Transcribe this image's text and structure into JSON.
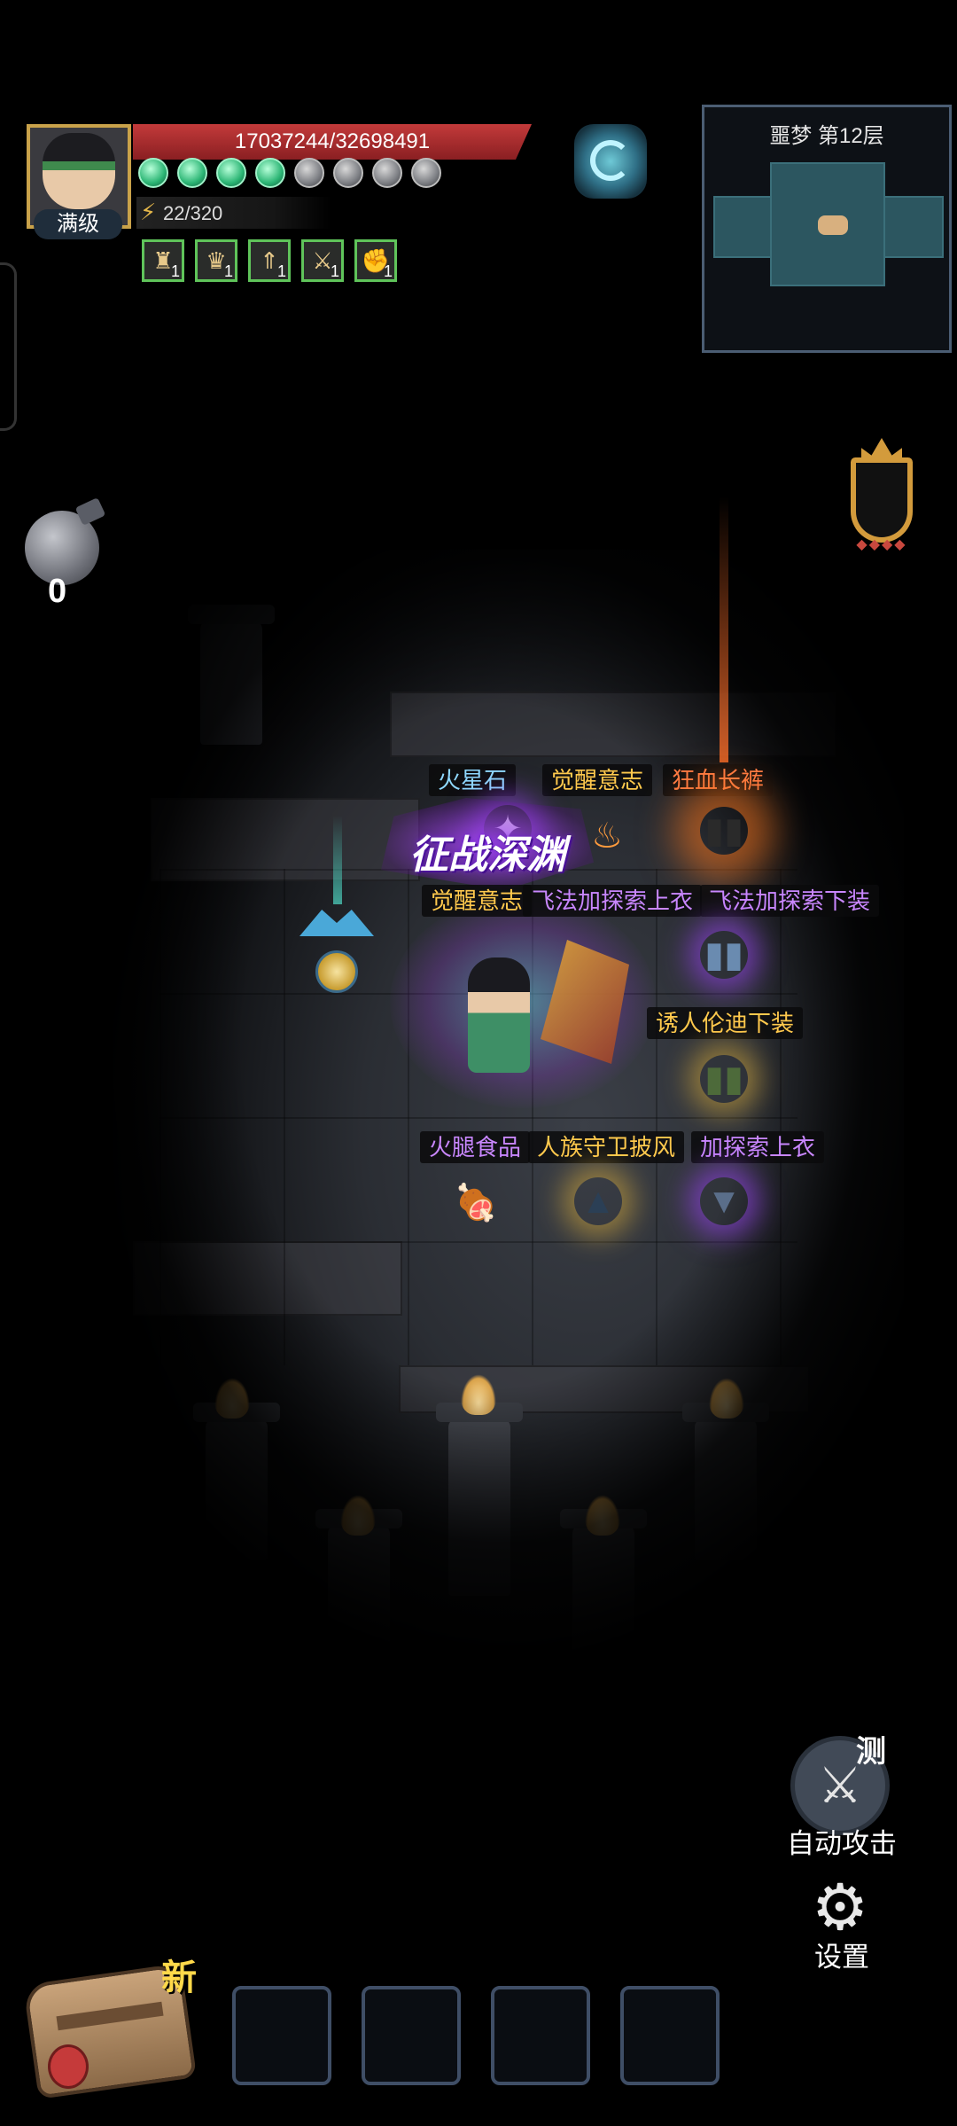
{
  "player": {
    "level_label": "满级",
    "hp_text": "17037244/32698491",
    "hp_current": 17037244,
    "hp_max": 32698491,
    "energy_text": "22/320",
    "orbs_active": 4,
    "orbs_total": 8,
    "buffs": [
      {
        "icon": "armor-icon",
        "count": "1"
      },
      {
        "icon": "helmet-icon",
        "count": "1"
      },
      {
        "icon": "rank-up-icon",
        "count": "1"
      },
      {
        "icon": "crossed-swords-icon",
        "count": "1"
      },
      {
        "icon": "strength-arm-icon",
        "count": "1"
      }
    ]
  },
  "minimap": {
    "title": "噩梦 第12层"
  },
  "bomb": {
    "count": "0"
  },
  "badge": {
    "text": "征战深渊"
  },
  "loot": {
    "row1": [
      {
        "label": "火星石",
        "color": "blue"
      },
      {
        "label": "觉醒意志",
        "color": "gold"
      },
      {
        "label": "狂血长裤",
        "color": "orange"
      }
    ],
    "row2": [
      {
        "label": "觉醒意志",
        "color": "gold"
      },
      {
        "label": "飞法加探索上衣",
        "color": "purple"
      },
      {
        "label": "飞法加探索下装",
        "color": "purple"
      }
    ],
    "row3": [
      {
        "label": "诱人伦迪下装",
        "color": "gold"
      }
    ],
    "row4": [
      {
        "label": "火腿食品",
        "color": "purple"
      },
      {
        "label": "人族守卫披风",
        "color": "gold"
      },
      {
        "label": "加探索上衣",
        "color": "purple"
      }
    ]
  },
  "controls": {
    "auto_attack_label": "自动攻击",
    "test_tag": "测",
    "settings_label": "设置"
  },
  "inventory": {
    "new_tag": "新",
    "slots": [
      "",
      "",
      "",
      ""
    ]
  },
  "colors": {
    "hp": "#c33a3a",
    "orb_active": "#2bb574",
    "loot_blue": "#8fd9ff",
    "loot_gold": "#ffc94d",
    "loot_orange": "#ff7b45",
    "loot_purple": "#c987ff"
  }
}
